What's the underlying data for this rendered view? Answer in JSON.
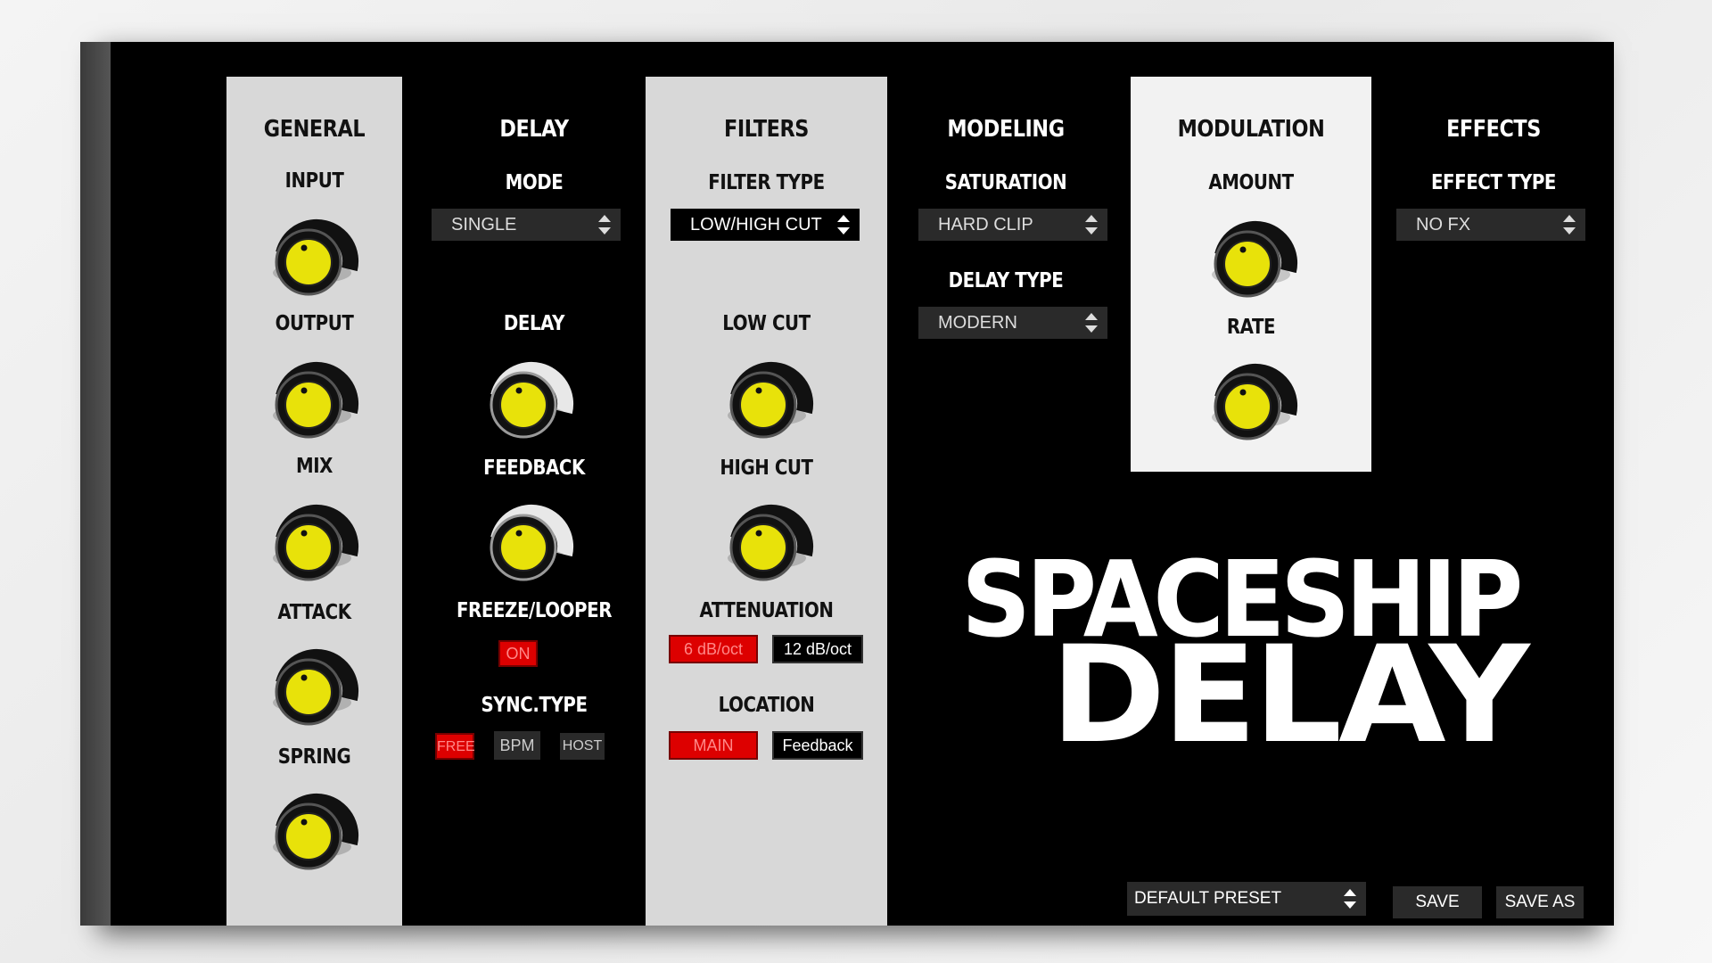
{
  "colors": {
    "accent": "#e8e20a",
    "active": "#dd0000",
    "panel_light": "#d8d8d8",
    "panel_bright": "#f2f2f2",
    "background": "#000000"
  },
  "general": {
    "title": "GENERAL",
    "knobs": [
      "INPUT",
      "OUTPUT",
      "MIX",
      "ATTACK",
      "SPRING"
    ]
  },
  "delay": {
    "title": "DELAY",
    "mode_label": "MODE",
    "mode_value": "SINGLE",
    "delay_label": "DELAY",
    "feedback_label": "FEEDBACK",
    "freeze_label": "FREEZE/LOOPER",
    "freeze_on": "ON",
    "sync_label": "SYNC.TYPE",
    "sync_options": [
      "FREE",
      "BPM",
      "HOST"
    ]
  },
  "filters": {
    "title": "FILTERS",
    "filter_type_label": "FILTER TYPE",
    "filter_type_value": "LOW/HIGH CUT",
    "low_cut": "LOW CUT",
    "high_cut": "HIGH CUT",
    "attenuation_label": "ATTENUATION",
    "attenuation_options": [
      "6 dB/oct",
      "12 dB/oct"
    ],
    "location_label": "LOCATION",
    "location_options": [
      "MAIN",
      "Feedback"
    ]
  },
  "modeling": {
    "title": "MODELING",
    "saturation_label": "SATURATION",
    "saturation_value": "HARD CLIP",
    "delay_type_label": "DELAY TYPE",
    "delay_type_value": "MODERN"
  },
  "modulation": {
    "title": "MODULATION",
    "amount": "AMOUNT",
    "rate": "RATE"
  },
  "effects": {
    "title": "EFFECTS",
    "effect_type_label": "EFFECT TYPE",
    "effect_type_value": "NO FX"
  },
  "brand": {
    "line1": "SPACESHIP",
    "line2": "DELAY"
  },
  "footer": {
    "preset": "DEFAULT PRESET",
    "save": "SAVE",
    "save_as": "SAVE AS"
  }
}
